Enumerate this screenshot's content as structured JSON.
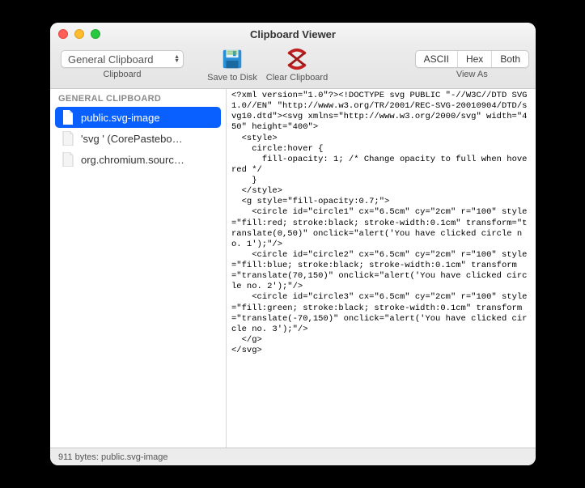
{
  "window": {
    "title": "Clipboard Viewer"
  },
  "toolbar": {
    "clipboard_select": {
      "value": "General Clipboard",
      "group_label": "Clipboard"
    },
    "save": {
      "group_label": "Save to Disk"
    },
    "clear": {
      "group_label": "Clear Clipboard"
    },
    "viewas": {
      "group_label": "View As",
      "segments": {
        "ascii": "ASCII",
        "hex": "Hex",
        "both": "Both"
      }
    }
  },
  "sidebar": {
    "header": "GENERAL CLIPBOARD",
    "items": [
      {
        "label": "public.svg-image"
      },
      {
        "label": "'svg ' (CorePastebo…"
      },
      {
        "label": "org.chromium.sourc…"
      }
    ]
  },
  "content": "<?xml version=\"1.0\"?><!DOCTYPE svg PUBLIC \"-//W3C//DTD SVG 1.0//EN\" \"http://www.w3.org/TR/2001/REC-SVG-20010904/DTD/svg10.dtd\"><svg xmlns=\"http://www.w3.org/2000/svg\" width=\"450\" height=\"400\">\n  <style>\n    circle:hover {\n      fill-opacity: 1; /* Change opacity to full when hovered */\n    }\n  </style>\n  <g style=\"fill-opacity:0.7;\">\n    <circle id=\"circle1\" cx=\"6.5cm\" cy=\"2cm\" r=\"100\" style=\"fill:red; stroke:black; stroke-width:0.1cm\" transform=\"translate(0,50)\" onclick=\"alert('You have clicked circle no. 1');\"/>\n    <circle id=\"circle2\" cx=\"6.5cm\" cy=\"2cm\" r=\"100\" style=\"fill:blue; stroke:black; stroke-width:0.1cm\" transform=\"translate(70,150)\" onclick=\"alert('You have clicked circle no. 2');\"/>\n    <circle id=\"circle3\" cx=\"6.5cm\" cy=\"2cm\" r=\"100\" style=\"fill:green; stroke:black; stroke-width:0.1cm\" transform=\"translate(-70,150)\" onclick=\"alert('You have clicked circle no. 3');\"/>\n  </g>\n</svg>",
  "status": "911 bytes: public.svg-image"
}
